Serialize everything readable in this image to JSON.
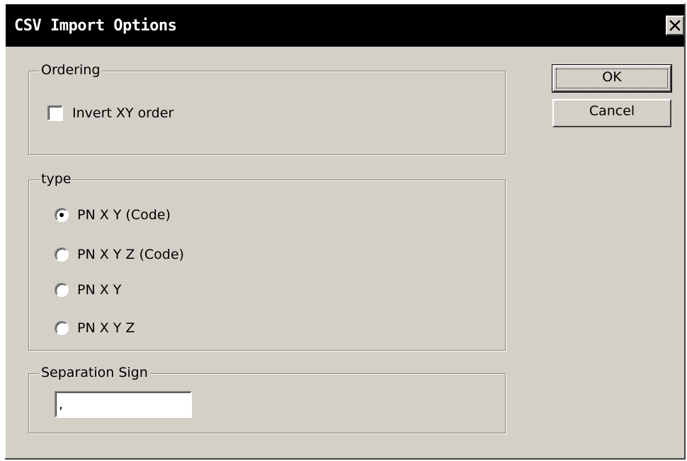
{
  "window": {
    "title": "CSV Import Options"
  },
  "ordering": {
    "legend": "Ordering",
    "invert_xy": {
      "label": "Invert XY order",
      "checked": false
    }
  },
  "type": {
    "legend": "type",
    "options": [
      {
        "label": "PN X Y (Code)",
        "selected": true
      },
      {
        "label": "PN X Y Z (Code)",
        "selected": false
      },
      {
        "label": "PN X Y",
        "selected": false
      },
      {
        "label": "PN X Y Z",
        "selected": false
      }
    ]
  },
  "separation": {
    "legend": "Separation Sign",
    "value": ","
  },
  "buttons": {
    "ok": "OK",
    "cancel": "Cancel"
  },
  "icons": {
    "close": "close-icon"
  },
  "colors": {
    "dialog_face": "#d4d0c8",
    "titlebar": "#000000",
    "title_text": "#ffffff"
  }
}
